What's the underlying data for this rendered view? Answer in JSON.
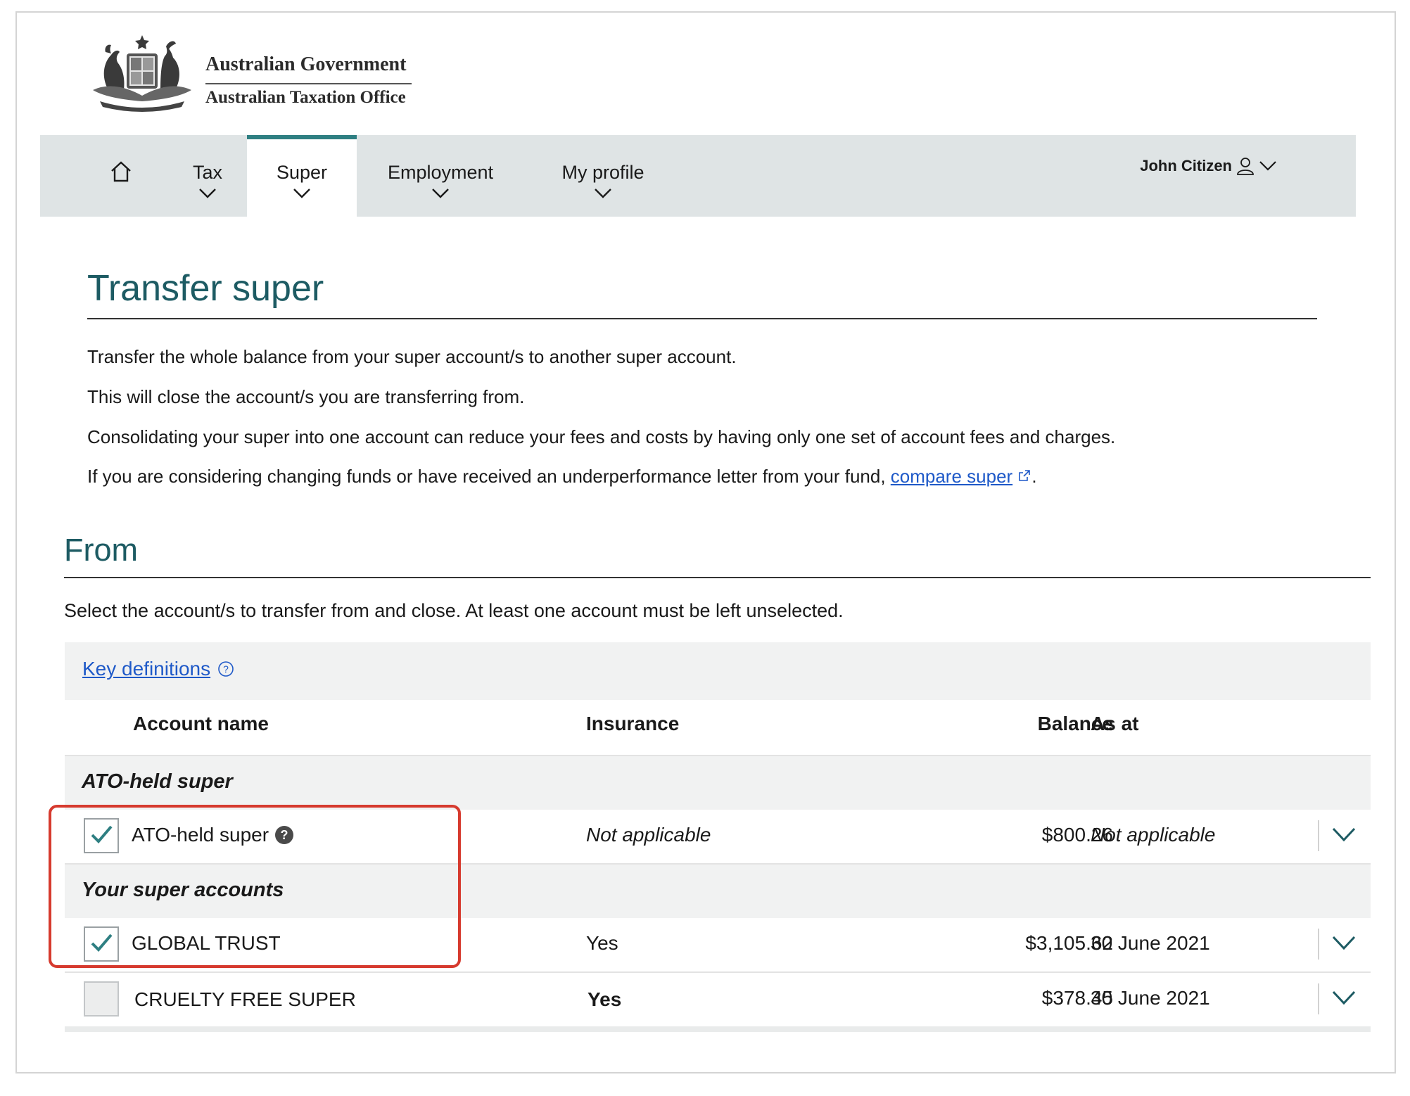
{
  "header": {
    "gov_name": "Australian Government",
    "office_name": "Australian Taxation Office"
  },
  "nav": {
    "items": [
      {
        "label": "Tax"
      },
      {
        "label": "Super"
      },
      {
        "label": "Employment"
      },
      {
        "label": "My profile"
      }
    ],
    "active": "Super",
    "user_name": "John Citizen"
  },
  "page": {
    "title": "Transfer super",
    "intro": [
      "Transfer the whole balance from your super account/s to another super account.",
      "This will close the account/s you are transferring from.",
      "Consolidating your super into one account can reduce your fees and costs by having only one set of account fees and charges."
    ],
    "compare_prefix": "If you are considering changing funds or have received an underperformance letter from your fund, ",
    "compare_link": "compare super",
    "compare_suffix": "."
  },
  "from_section": {
    "title": "From",
    "instruction": "Select the account/s to transfer from and close. At least one account must be left unselected.",
    "key_definitions": "Key definitions",
    "columns": {
      "account_name": "Account name",
      "insurance": "Insurance",
      "balance": "Balance",
      "as_at": "As at"
    },
    "groups": [
      {
        "label": "ATO-held super",
        "rows": [
          {
            "name": "ATO-held super",
            "insurance": "Not applicable",
            "balance": "$800.26",
            "as_at": "Not applicable",
            "checked": true
          }
        ]
      },
      {
        "label": "Your super accounts",
        "rows": [
          {
            "name": "GLOBAL TRUST",
            "insurance": "Yes",
            "balance": "$3,105.62",
            "as_at": "30 June 2021",
            "checked": true
          },
          {
            "name": "CRUELTY FREE SUPER",
            "insurance": "Yes",
            "balance": "$378.45",
            "as_at": "30 June 2021",
            "checked": false
          }
        ]
      }
    ]
  },
  "colors": {
    "heading_teal": "#1d5b63",
    "nav_accent": "#2e7f82",
    "link_blue": "#1e59c8",
    "highlight_red": "#d63a2e"
  }
}
